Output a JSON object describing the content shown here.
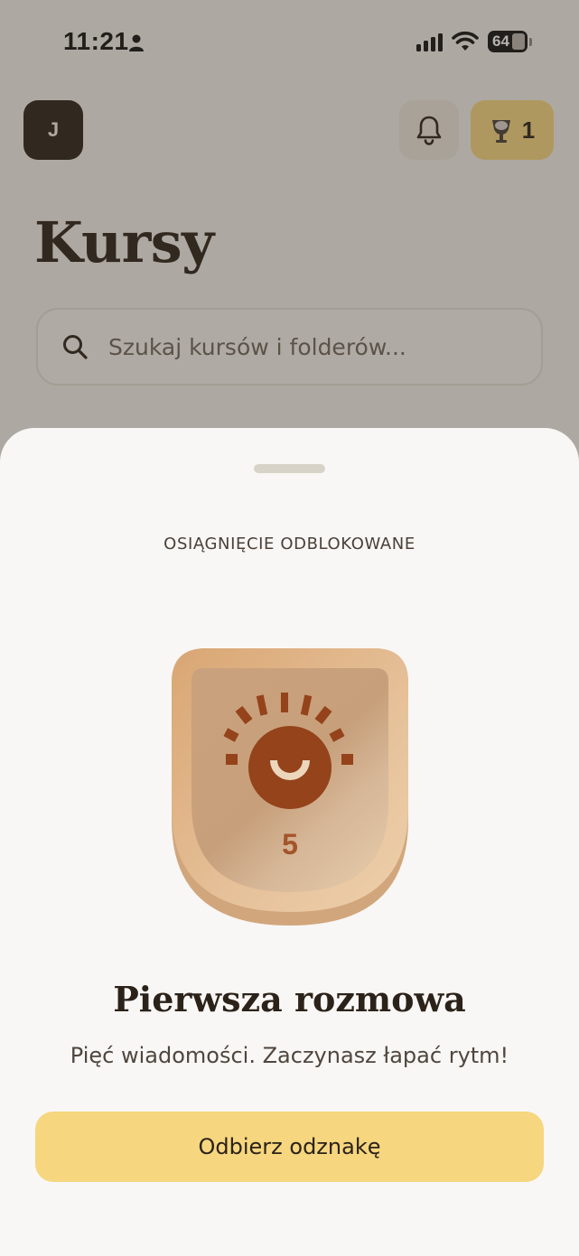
{
  "status_bar": {
    "time": "11:21",
    "battery": "64"
  },
  "header": {
    "avatar_initial": "J",
    "trophy_count": "1"
  },
  "page": {
    "title": "Kursy",
    "search_placeholder": "Szukaj kursów i folderów..."
  },
  "sheet": {
    "kicker": "OSIĄGNIĘCIE ODBLOKOWANE",
    "badge_level": "5",
    "badge_icon": "sunrise-icon",
    "title": "Pierwsza rozmowa",
    "description": "Pięć wiadomości. Zaczynasz łapać rytm!",
    "claim_button": "Odbierz odznakę"
  },
  "colors": {
    "accent_yellow": "#f6d67e",
    "dark_brown": "#2b2219",
    "badge_bronze": "#deb083",
    "badge_icon": "#94431a"
  }
}
